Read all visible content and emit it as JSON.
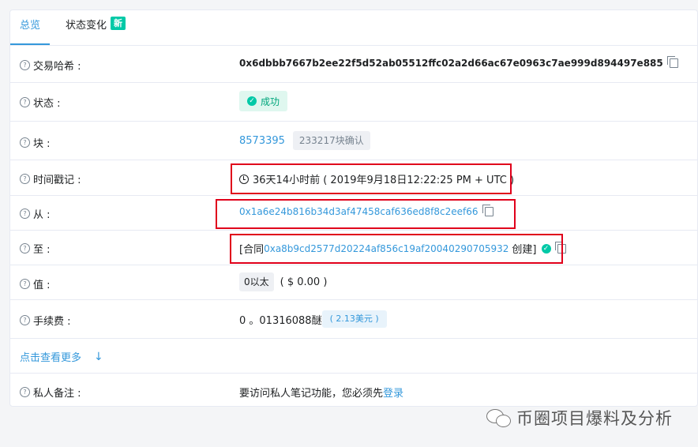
{
  "tabs": {
    "overview": "总览",
    "state_changes": "状态变化",
    "new_badge": "新"
  },
  "rows": {
    "hash": {
      "label": "交易哈希 :",
      "value": "0x6dbbb7667b2ee22f5d52ab05512ffc02a2d66ac67e0963c7ae999d894497e885"
    },
    "status": {
      "label": "状态 :",
      "value": "成功"
    },
    "block": {
      "label": "块 :",
      "value": "8573395",
      "confirmations": "233217块确认"
    },
    "timestamp": {
      "label": "时间戳记 :",
      "value": "36天14小时前 ( 2019年9月18日12:22:25 PM + UTC )"
    },
    "from": {
      "label": "从 :",
      "value": "0x1a6e24b816b34d3af47458caf636ed8f8c2eef66"
    },
    "to": {
      "label": "至 :",
      "prefix": "[合同",
      "address": "0xa8b9cd2577d20224af856c19af20040290705932",
      "suffix": "创建]"
    },
    "value": {
      "label": "值 :",
      "eth": "0以太",
      "usd": "( $ 0.00 )"
    },
    "fee": {
      "label": "手续费 :",
      "value": "0 。01316088醚",
      "usd": "( 2.13美元 )"
    },
    "note": {
      "label": "私人备注 :",
      "text": "要访问私人笔记功能，您必须先",
      "link": "登录"
    }
  },
  "more": {
    "label": "点击查看更多"
  },
  "watermark": "币圈项目爆料及分析",
  "colors": {
    "accent": "#3498db",
    "success": "#00c9a7",
    "highlight": "#e0001b"
  }
}
